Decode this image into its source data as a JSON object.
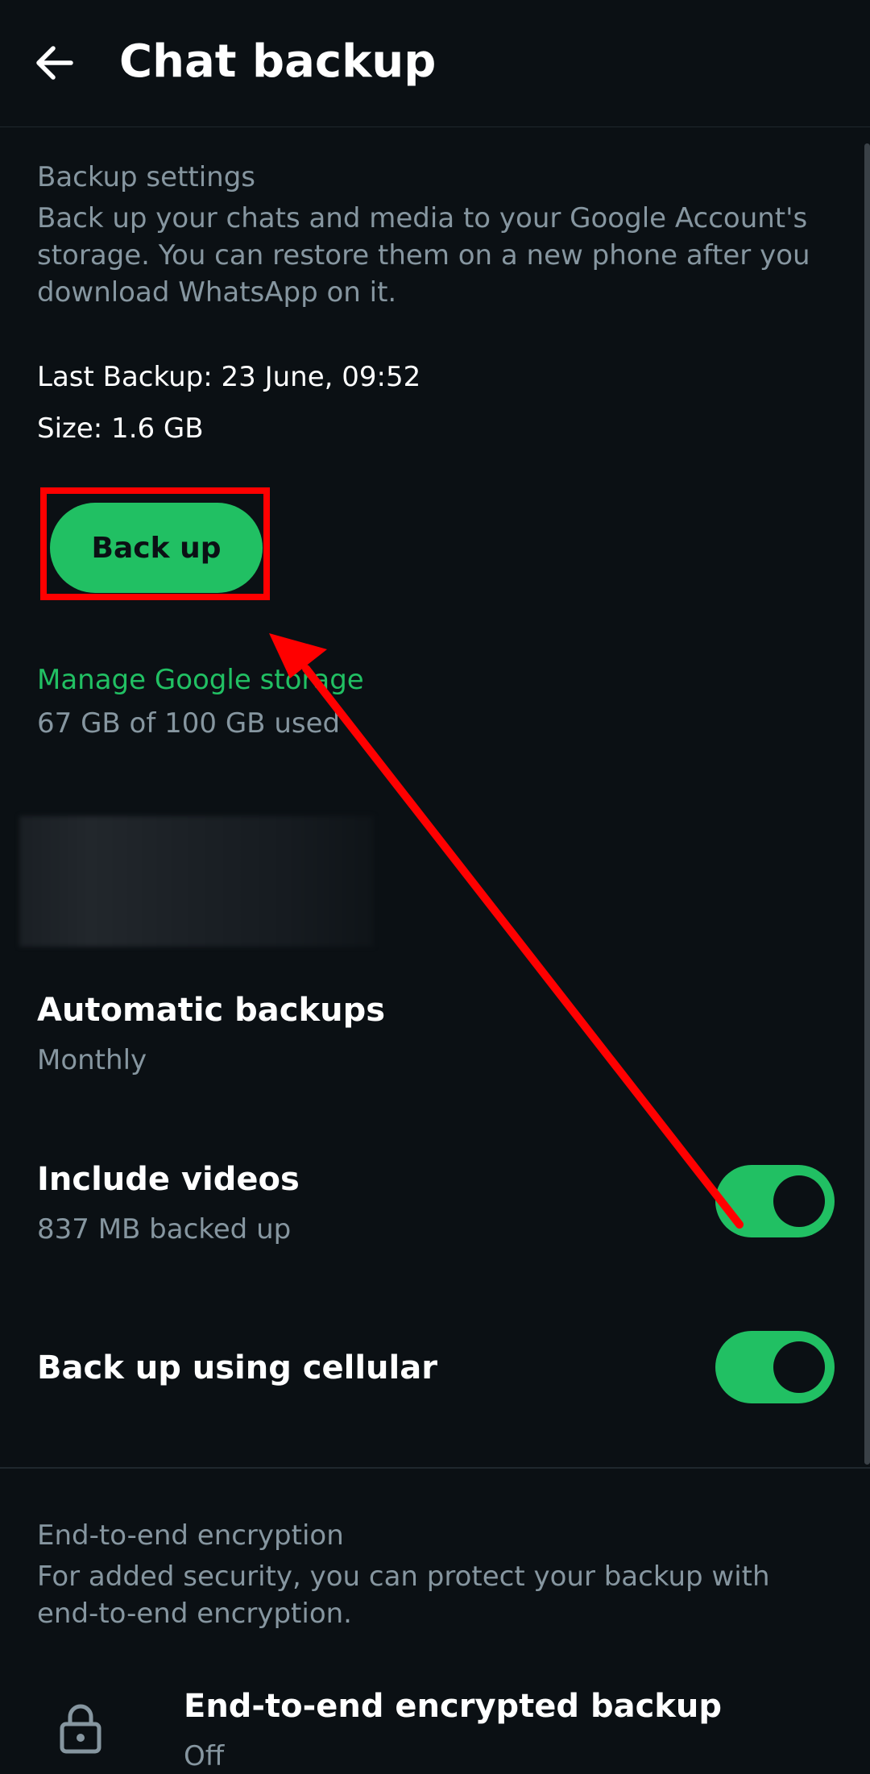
{
  "appbar": {
    "title": "Chat backup",
    "back_icon": "arrow-left-icon"
  },
  "backup_settings": {
    "label": "Backup settings",
    "description": "Back up your chats and media to your Google Account's storage. You can restore them on a new phone after you download WhatsApp on it.",
    "last_backup": "Last Backup: 23 June, 09:52",
    "size": "Size: 1.6 GB",
    "backup_button": "Back up"
  },
  "google_storage": {
    "link": "Manage Google storage",
    "usage": "67 GB of 100 GB used"
  },
  "automatic_backups": {
    "title": "Automatic backups",
    "value": "Monthly"
  },
  "include_videos": {
    "title": "Include videos",
    "subtitle": "837 MB backed up",
    "enabled": true
  },
  "cellular": {
    "title": "Back up using cellular",
    "enabled": true
  },
  "encryption": {
    "label": "End-to-end encryption",
    "description": "For added security, you can protect your backup with end-to-end encryption.",
    "row_title": "End-to-end encrypted backup",
    "row_value": "Off",
    "icon": "lock-icon"
  },
  "colors": {
    "accent": "#21c063",
    "background": "#0b1014",
    "secondary_text": "#8696a0",
    "annotation": "#ff0000"
  }
}
